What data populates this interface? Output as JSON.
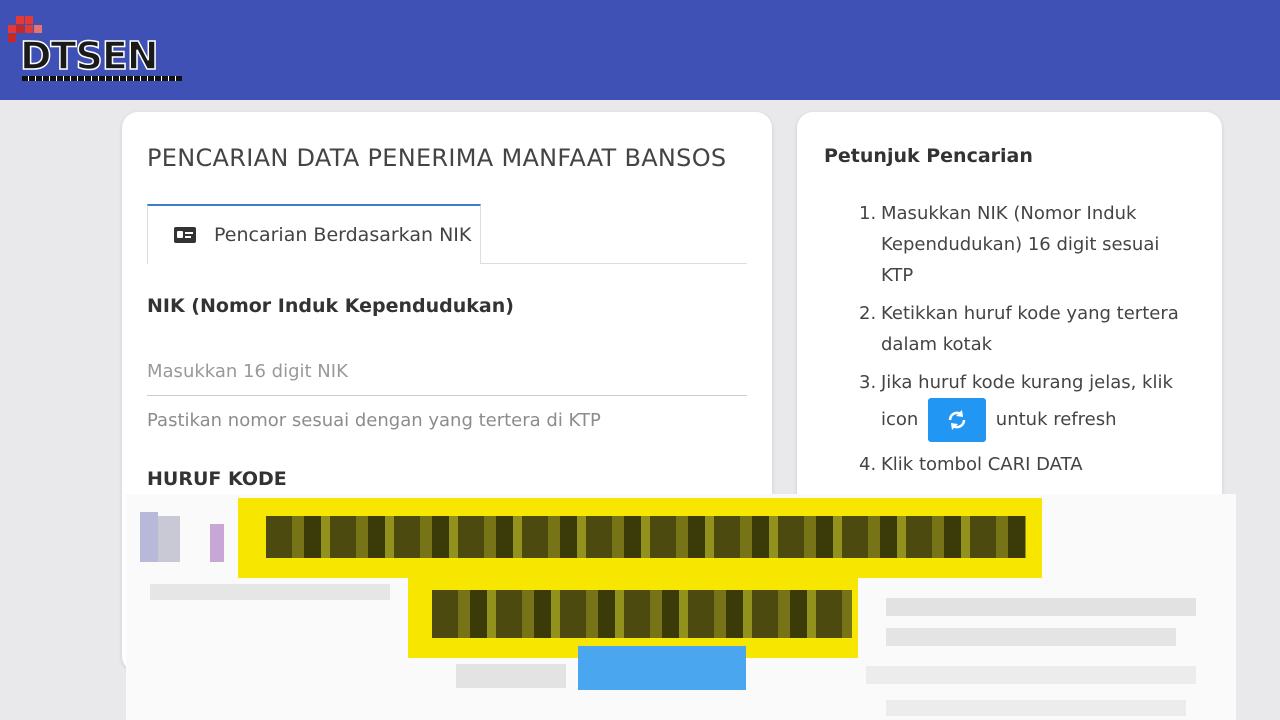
{
  "header": {
    "logo_text": "DTSEN",
    "logo_subtitle": "Data Tunggal Sosial dan Ekonomi Nasional",
    "bg_color": "#3f51b5"
  },
  "search_card": {
    "title": "PENCARIAN DATA PENERIMA MANFAAT BANSOS",
    "tab": {
      "icon": "id-card-icon",
      "label": "Pencarian Berdasarkan NIK"
    },
    "nik_label": "NIK (Nomor Induk Kependudukan)",
    "nik_placeholder": "Masukkan 16 digit NIK",
    "nik_value": "",
    "nik_help": "Pastikan nomor sesuai dengan yang tertera di KTP",
    "kode_label": "HURUF KODE"
  },
  "guide_card": {
    "title": "Petunjuk Pencarian",
    "steps": [
      {
        "num": "1.",
        "text": "Masukkan NIK (Nomor Induk Kependudukan) 16 digit sesuai KTP"
      },
      {
        "num": "2.",
        "text": "Ketikkan huruf kode yang tertera dalam kotak"
      },
      {
        "num": "3.",
        "text_before": "Jika huruf kode kurang jelas, klik icon",
        "icon": "refresh-icon",
        "text_after": "untuk refresh"
      },
      {
        "num": "4.",
        "text": "Klik tombol CARI DATA"
      }
    ],
    "accent_color": "#2196f3"
  }
}
